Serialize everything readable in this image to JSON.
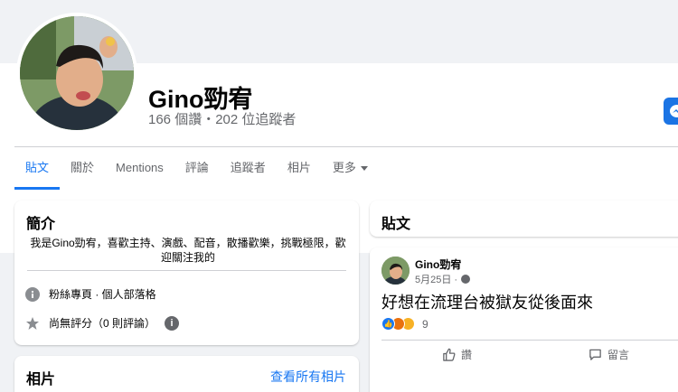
{
  "profile": {
    "name": "Gino勁宥",
    "stats": "166 個讚・202 位追蹤者"
  },
  "tabs": [
    {
      "label": "貼文",
      "active": true
    },
    {
      "label": "關於"
    },
    {
      "label": "Mentions"
    },
    {
      "label": "評論"
    },
    {
      "label": "追蹤者"
    },
    {
      "label": "相片"
    },
    {
      "label": "更多"
    }
  ],
  "intro": {
    "title": "簡介",
    "bio": "我是Gino勁宥，喜歡主持、演戲、配音，散播歡樂，挑戰極限，歡迎關注我的",
    "page_type": "粉絲專頁 · 個人部落格",
    "rating": "尚無評分（0 則評論）"
  },
  "photos": {
    "title": "相片",
    "see_all": "查看所有相片"
  },
  "posts": {
    "title": "貼文"
  },
  "post": {
    "author": "Gino勁宥",
    "date": "5月25日 ·",
    "text": "好想在流理台被獄友從後面來",
    "reaction_count": "9",
    "like_label": "讚",
    "comment_label": "留言"
  },
  "colors": {
    "accent": "#1877f2",
    "background": "#f0f2f5",
    "muted_text": "#65676b"
  }
}
